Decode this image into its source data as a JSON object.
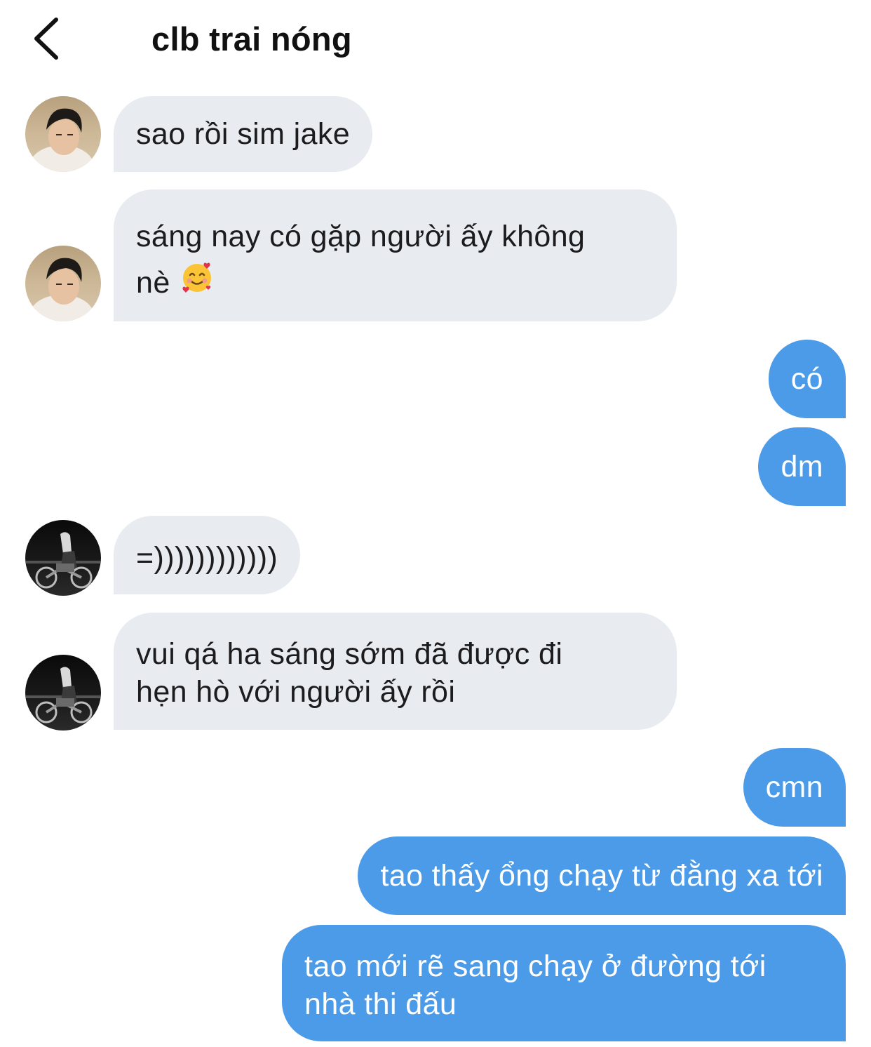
{
  "header": {
    "title": "clb trai nóng",
    "back_icon": "chevron-left-icon"
  },
  "messages": [
    {
      "direction": "incoming",
      "sender_avatar": "avatar-beach",
      "lines": [
        "sao rồi sim jake"
      ]
    },
    {
      "direction": "incoming",
      "sender_avatar": "avatar-beach",
      "lines": [
        "sáng nay có gặp người ấy không",
        "nè"
      ],
      "emoji": "smiling-face-with-hearts-emoji"
    },
    {
      "direction": "outgoing",
      "lines": [
        "có"
      ]
    },
    {
      "direction": "outgoing",
      "lines": [
        "dm"
      ]
    },
    {
      "direction": "incoming",
      "sender_avatar": "avatar-motorbike",
      "lines": [
        "=))))))))))))"
      ]
    },
    {
      "direction": "incoming",
      "sender_avatar": "avatar-motorbike",
      "lines": [
        "vui qá ha sáng sớm đã được đi",
        "hẹn hò với người ấy rồi"
      ]
    },
    {
      "direction": "outgoing",
      "lines": [
        "cmn"
      ]
    },
    {
      "direction": "outgoing",
      "lines": [
        "tao thấy ổng chạy từ đằng xa tới"
      ]
    },
    {
      "direction": "outgoing",
      "lines": [
        "tao mới rẽ sang chạy ở đường tới",
        "nhà thi đấu"
      ]
    }
  ],
  "colors": {
    "incoming_bubble": "#e8ebf0",
    "outgoing_bubble": "#4c9be8",
    "outgoing_text": "#ffffff",
    "incoming_text": "#1c1c1e"
  }
}
